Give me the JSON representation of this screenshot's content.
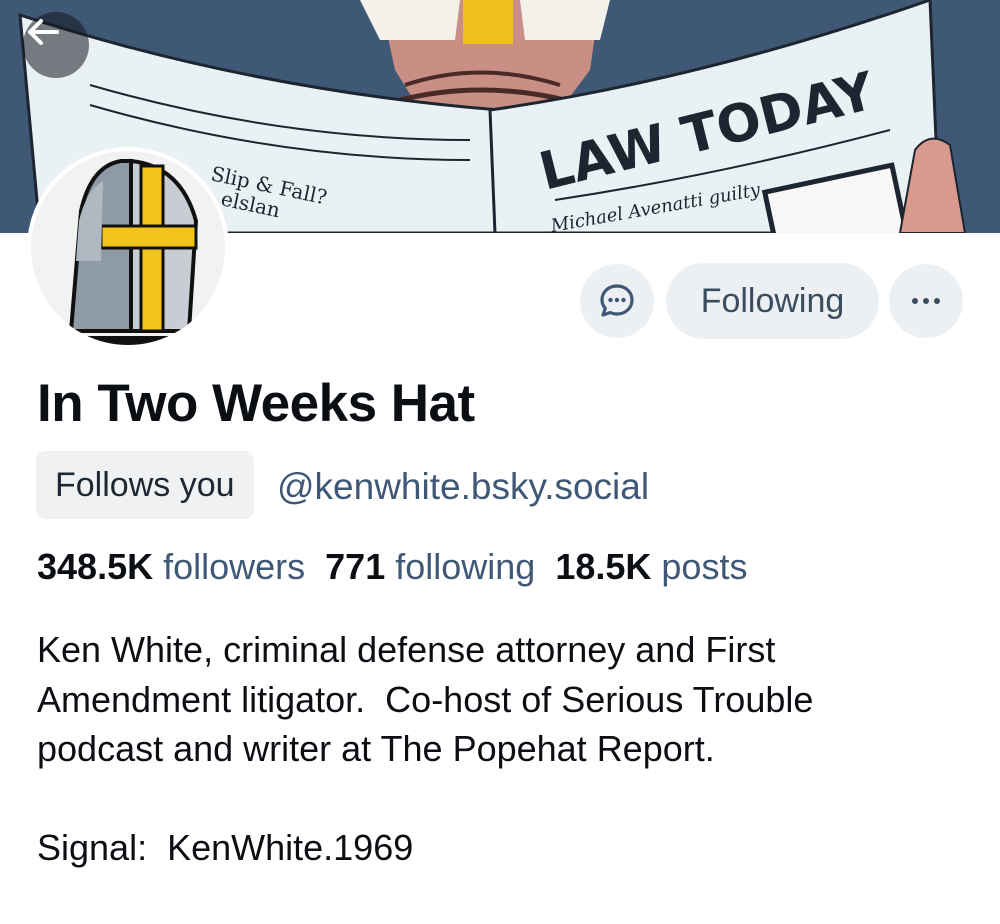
{
  "banner": {
    "newspaper_title": "LAW TODAY",
    "headline_left": "Slip & Fall?",
    "headline_left_2": "elslan",
    "headline_right": "Michael Avenatti guilty"
  },
  "profile": {
    "display_name": "In Two Weeks Hat",
    "follows_you_label": "Follows you",
    "handle": "@kenwhite.bsky.social",
    "followers_count": "348.5K",
    "followers_label": "followers",
    "following_count": "771",
    "following_label": "following",
    "posts_count": "18.5K",
    "posts_label": "posts",
    "bio": "Ken White, criminal defense attorney and First\nAmendment litigator.  Co-host of Serious Trouble\npodcast and writer at The Popehat Report.\n\nSignal:  KenWhite.1969"
  },
  "actions": {
    "following_label": "Following",
    "more_label": "···"
  },
  "icons": {
    "back": "arrow-left-icon",
    "message": "chat-bubble-icon",
    "more": "ellipsis-icon"
  },
  "colors": {
    "accent": "#3f5875",
    "button_bg": "#edf0f3",
    "badge_bg": "#f0f1f3",
    "text": "#0b0f14"
  }
}
